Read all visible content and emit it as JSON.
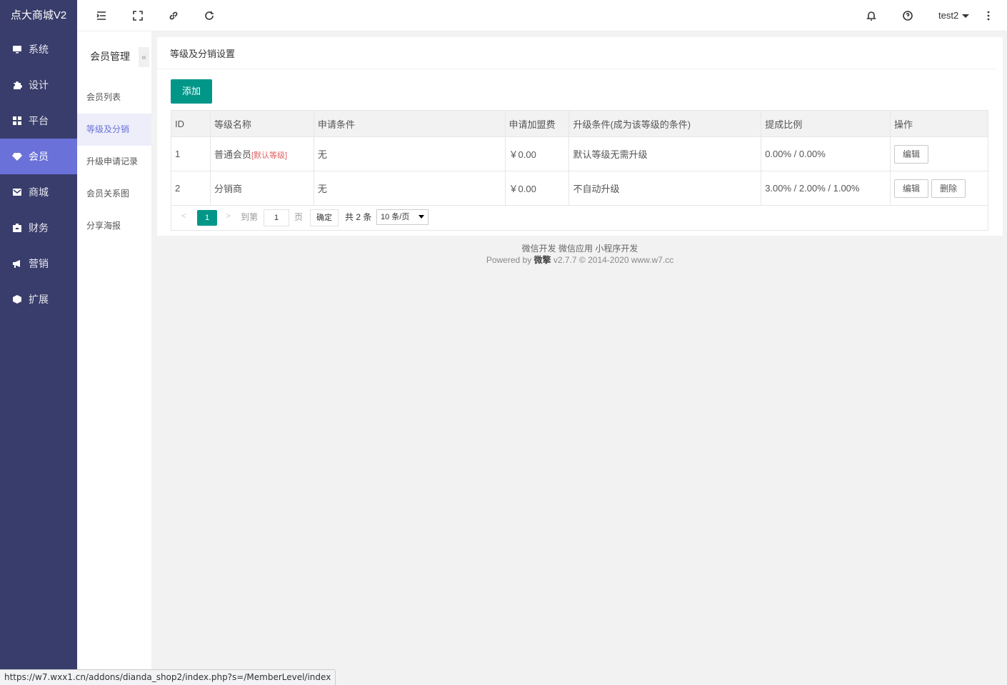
{
  "app": {
    "title": "点大商城V2"
  },
  "nav": [
    {
      "label": "系统",
      "icon": "monitor-icon"
    },
    {
      "label": "设计",
      "icon": "puzzle-icon"
    },
    {
      "label": "平台",
      "icon": "grid-icon"
    },
    {
      "label": "会员",
      "icon": "gem-icon",
      "active": true
    },
    {
      "label": "商城",
      "icon": "envelope-icon"
    },
    {
      "label": "财务",
      "icon": "wallet-icon"
    },
    {
      "label": "营销",
      "icon": "megaphone-icon"
    },
    {
      "label": "扩展",
      "icon": "cube-icon"
    }
  ],
  "subnav": {
    "title": "会员管理",
    "collapse_glyph": "«",
    "items": [
      {
        "label": "会员列表"
      },
      {
        "label": "等级及分销",
        "active": true
      },
      {
        "label": "升级申请记录"
      },
      {
        "label": "会员关系图"
      },
      {
        "label": "分享海报"
      }
    ]
  },
  "topbar": {
    "icons": [
      "menu-fold-icon",
      "fullscreen-icon",
      "link-icon",
      "refresh-icon",
      "bell-icon",
      "help-icon",
      "more-vertical-icon"
    ],
    "user": "test2"
  },
  "card": {
    "title": "等级及分销设置",
    "add_label": "添加"
  },
  "table": {
    "headers": [
      "ID",
      "等级名称",
      "申请条件",
      "申请加盟费",
      "升级条件(成为该等级的条件)",
      "提成比例",
      "操作"
    ],
    "rows": [
      {
        "id": "1",
        "name": "普通会员",
        "tag": "[默认等级]",
        "apply": "无",
        "fee": "￥0.00",
        "upgrade": "默认等级无需升级",
        "ratio": "0.00% / 0.00%",
        "actions": [
          "编辑"
        ]
      },
      {
        "id": "2",
        "name": "分销商",
        "tag": "",
        "apply": "无",
        "fee": "￥0.00",
        "upgrade": "不自动升级",
        "ratio": "3.00% / 2.00% / 1.00%",
        "actions": [
          "编辑",
          "删除"
        ]
      }
    ]
  },
  "pager": {
    "prev": "<",
    "current": "1",
    "next": ">",
    "goto_label": "到第",
    "goto_value": "1",
    "page_unit": "页",
    "confirm": "确定",
    "total": "共 2 条",
    "page_size": "10 条/页"
  },
  "footer": {
    "links": "微信开发 微信应用 小程序开发",
    "powered_prefix": "Powered by",
    "brand": "微擎",
    "powered_suffix": "v2.7.7 © 2014-2020 www.w7.cc"
  },
  "statusbar": {
    "url": "https://w7.wxx1.cn/addons/dianda_shop2/index.php?s=/MemberLevel/index"
  }
}
